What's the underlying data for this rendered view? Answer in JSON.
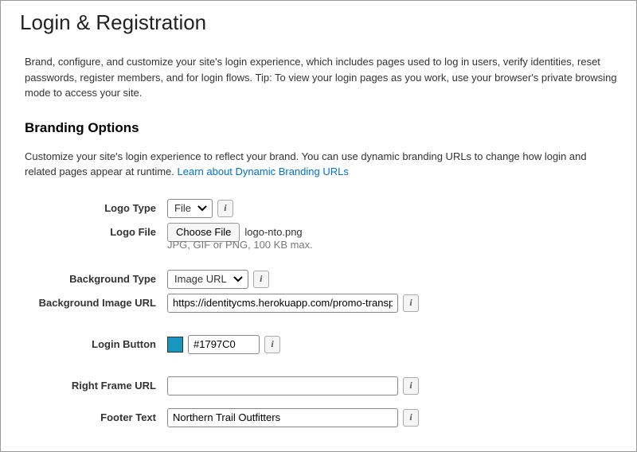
{
  "page": {
    "title": "Login & Registration",
    "description": "Brand, configure, and customize your site's login experience, which includes pages used to log in users, verify identities, reset passwords, register members, and for login flows. Tip: To view your login pages as you work, use your browser's private browsing mode to access your site."
  },
  "branding": {
    "section_title": "Branding Options",
    "section_desc_prefix": "Customize your site's login experience to reflect your brand. You can use dynamic branding URLs to change how login and related pages appear at runtime. ",
    "link_text": "Learn about Dynamic Branding URLs",
    "logo_type": {
      "label": "Logo Type",
      "value": "File"
    },
    "logo_file": {
      "label": "Logo File",
      "button": "Choose File",
      "filename": "logo-nto.png",
      "hint": "JPG, GIF or PNG, 100 KB max."
    },
    "background_type": {
      "label": "Background Type",
      "value": "Image URL"
    },
    "background_image_url": {
      "label": "Background Image URL",
      "value": "https://identitycms.herokuapp.com/promo-transp"
    },
    "login_button": {
      "label": "Login Button",
      "color": "#1797C0"
    },
    "right_frame_url": {
      "label": "Right Frame URL",
      "value": ""
    },
    "footer_text": {
      "label": "Footer Text",
      "value": "Northern Trail Outfitters"
    }
  }
}
